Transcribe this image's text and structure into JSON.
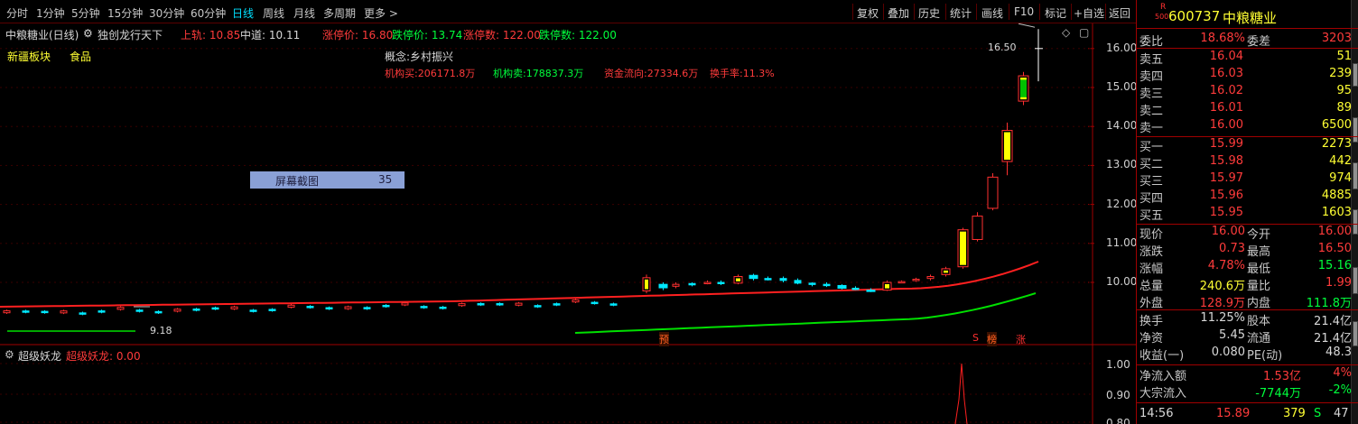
{
  "toolbar": {
    "periods": [
      "分时",
      "1分钟",
      "5分钟",
      "15分钟",
      "30分钟",
      "60分钟",
      "日线",
      "周线",
      "月线",
      "多周期",
      "更多 >"
    ],
    "active_period": "日线",
    "buttons": [
      "复权",
      "叠加",
      "历史",
      "统计",
      "画线",
      "F10",
      "标记",
      "+自选",
      "返回"
    ]
  },
  "info_row1": {
    "name_period": "中粮糖业(日线)",
    "formula_icon": "gear-icon",
    "formula": "独创龙行天下",
    "upper_label": "上轨: 10.85",
    "middle_label": "中道: 10.11",
    "limit_up_price": "涨停价: 16.80",
    "limit_down_price": "跌停价: 13.74",
    "limit_up_count": "涨停数: 122.00",
    "limit_down_count": "跌停数: 122.00"
  },
  "info_row2": {
    "sector": "新疆板块",
    "industry": "食品",
    "concept": "概念:乡村振兴"
  },
  "info_row3": {
    "inst_buy": "机构买:206171.8万",
    "inst_sell": "机构卖:178837.3万",
    "fund_flow": "资金流向:27334.6万",
    "turnover": "换手率:11.3%"
  },
  "overlay_box": {
    "label": "屏幕截图",
    "value": "35"
  },
  "price_axis": [
    "16.00",
    "15.00",
    "14.00",
    "13.00",
    "12.00",
    "11.00",
    "10.00"
  ],
  "high_note": "16.50",
  "low_note": "9.18",
  "markers": {
    "yu": "预",
    "s": "S",
    "bang": "榜",
    "zhang": "涨"
  },
  "indicator": {
    "name": "超级妖龙",
    "value_label": "超级妖龙: 0.00",
    "axis": [
      "1.00",
      "0.90",
      "0.80"
    ]
  },
  "colors": {
    "up": "#ff3232",
    "down": "#00ffff",
    "ma_red": "#ff2020",
    "ma_green": "#00e000",
    "yellow": "#ffff00"
  },
  "panel": {
    "r_badge": "R",
    "r_sub": "500",
    "code": "600737",
    "name": "中粮糖业",
    "weibi_label": "委比",
    "weibi_value": "18.68%",
    "weicha_label": "委差",
    "weicha_value": "3203",
    "asks": [
      {
        "label": "卖五",
        "price": "16.04",
        "vol": "51"
      },
      {
        "label": "卖四",
        "price": "16.03",
        "vol": "239"
      },
      {
        "label": "卖三",
        "price": "16.02",
        "vol": "95"
      },
      {
        "label": "卖二",
        "price": "16.01",
        "vol": "89"
      },
      {
        "label": "卖一",
        "price": "16.00",
        "vol": "6500"
      }
    ],
    "bids": [
      {
        "label": "买一",
        "price": "15.99",
        "vol": "2273"
      },
      {
        "label": "买二",
        "price": "15.98",
        "vol": "442"
      },
      {
        "label": "买三",
        "price": "15.97",
        "vol": "974"
      },
      {
        "label": "买四",
        "price": "15.96",
        "vol": "4885"
      },
      {
        "label": "买五",
        "price": "15.95",
        "vol": "1603"
      }
    ],
    "stats": [
      {
        "l1": "现价",
        "v1": "16.00",
        "l2": "今开",
        "v2": "16.00"
      },
      {
        "l1": "涨跌",
        "v1": "0.73",
        "l2": "最高",
        "v2": "16.50"
      },
      {
        "l1": "涨幅",
        "v1": "4.78%",
        "l2": "最低",
        "v2": "15.16"
      },
      {
        "l1": "总量",
        "v1": "240.6万",
        "l2": "量比",
        "v2": "1.99"
      },
      {
        "l1": "外盘",
        "v1": "128.9万",
        "l2": "内盘",
        "v2": "111.8万"
      }
    ],
    "stats2": [
      {
        "l1": "换手",
        "v1": "11.25%",
        "l2": "股本",
        "v2": "21.4亿"
      },
      {
        "l1": "净资",
        "v1": "5.45",
        "l2": "流通",
        "v2": "21.4亿"
      },
      {
        "l1": "收益(一)",
        "v1": "0.080",
        "l2": "PE(动)",
        "v2": "48.3"
      }
    ],
    "flow": [
      {
        "label": "净流入额",
        "value": "1.53亿",
        "pct": "4%"
      },
      {
        "label": "大宗流入",
        "value": "-7744万",
        "pct": "-2%"
      }
    ],
    "tick": {
      "time": "14:56",
      "price": "15.89",
      "vol": "379",
      "side": "S",
      "count": "47"
    }
  }
}
